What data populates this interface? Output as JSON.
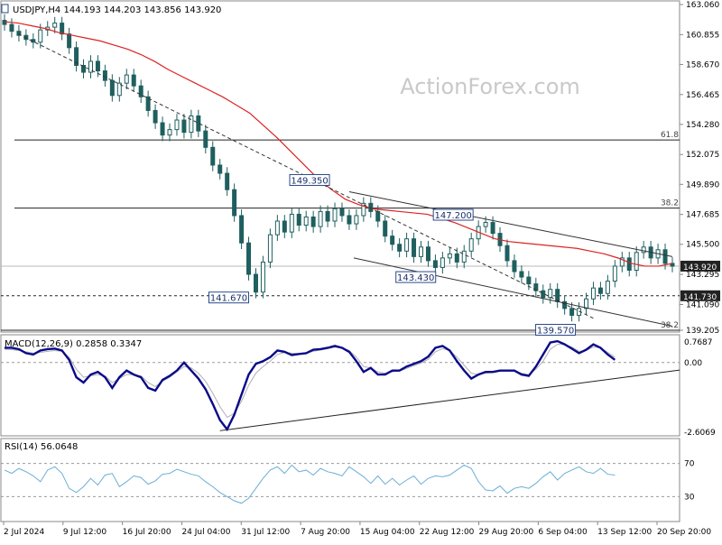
{
  "header": {
    "symbol_line": "USDJPY,H4  144.193 144.203 143.856 143.920",
    "watermark": "ActionForex.com"
  },
  "colors": {
    "candle": "#1f5f5f",
    "sma": "#dd2222",
    "macd_line": "#0a0a8a",
    "macd_signal": "#b0b0b0",
    "rsi": "#6aaed6",
    "trend": "#333333"
  },
  "chart_data": [
    {
      "type": "line",
      "title": "USDJPY,H4",
      "ohlc_last": {
        "open": 144.193,
        "high": 144.203,
        "low": 143.856,
        "close": 143.92
      },
      "x_ticks": [
        "2 Jul 2024",
        "9 Jul 12:00",
        "16 Jul 20:00",
        "24 Jul 04:00",
        "31 Jul 12:00",
        "7 Aug 20:00",
        "15 Aug 04:00",
        "22 Aug 12:00",
        "29 Aug 20:00",
        "6 Sep 04:00",
        "13 Sep 12:00",
        "20 Sep 20:00"
      ],
      "y_ticks": [
        "163.060",
        "160.855",
        "158.670",
        "156.465",
        "154.280",
        "152.075",
        "149.890",
        "147.685",
        "145.500",
        "143.295",
        "141.090",
        "139.205"
      ],
      "ylim": [
        139.205,
        163.06
      ],
      "close_series": [
        161.6,
        161.1,
        160.8,
        160.5,
        160.3,
        161.2,
        161.4,
        161.7,
        160.9,
        159.9,
        158.6,
        158.1,
        158.9,
        158.2,
        157.5,
        156.4,
        157.3,
        157.9,
        157.1,
        156.3,
        155.3,
        154.4,
        153.5,
        153.9,
        154.6,
        153.7,
        154.9,
        153.8,
        152.6,
        151.3,
        150.7,
        149.5,
        147.6,
        145.6,
        143.3,
        142.0,
        144.2,
        146.2,
        147.2,
        146.4,
        147.7,
        146.9,
        147.5,
        146.8,
        147.9,
        147.2,
        148.1,
        147.6,
        147.0,
        147.6,
        148.5,
        147.9,
        147.2,
        146.1,
        145.5,
        145.0,
        145.9,
        144.6,
        145.3,
        144.3,
        143.8,
        144.5,
        144.8,
        144.2,
        145.0,
        145.9,
        146.8,
        147.1,
        146.3,
        145.4,
        144.3,
        143.5,
        143.1,
        142.6,
        142.1,
        141.6,
        142.2,
        141.3,
        140.8,
        140.3,
        140.8,
        141.5,
        142.3,
        141.9,
        142.8,
        143.9,
        144.5,
        143.6,
        144.9,
        145.3,
        144.5,
        145.1,
        144.1,
        143.9
      ],
      "sma_series": [
        161.8,
        161.7,
        161.5,
        161.3,
        161.0,
        160.8,
        160.6,
        160.4,
        160.1,
        159.8,
        159.4,
        158.9,
        158.3,
        157.8,
        157.3,
        156.8,
        156.3,
        155.7,
        155.1,
        154.2,
        153.3,
        152.3,
        151.3,
        150.3,
        149.5,
        148.8,
        148.4,
        148.1,
        148.0,
        147.9,
        147.8,
        147.7,
        147.4,
        147.1,
        146.7,
        146.3,
        145.9,
        145.7,
        145.6,
        145.5,
        145.4,
        145.3,
        145.2,
        145.0,
        144.8,
        144.5,
        144.1,
        143.9,
        143.9,
        144.1
      ],
      "levels": [
        {
          "label": "61.8",
          "value": 153.14
        },
        {
          "label": "38.2",
          "value": 148.15
        }
      ],
      "level_bottom_label": "38.2",
      "support_value": 141.73,
      "support_label": "141.730",
      "current_price_label": "143.920",
      "annotations": [
        "149.350",
        "147.200",
        "143.430",
        "141.670",
        "139.570"
      ]
    },
    {
      "type": "line",
      "title": "MACD(12,26,9) 0.2858 0.3347",
      "y_ticks": [
        "0.7687",
        "0.00",
        "-2.6069"
      ],
      "ylim": [
        -2.6069,
        0.7687
      ],
      "macd_series": [
        0.55,
        0.55,
        0.5,
        0.35,
        0.3,
        0.45,
        0.5,
        0.52,
        0.45,
        0.1,
        -0.55,
        -0.75,
        -0.45,
        -0.35,
        -0.55,
        -0.95,
        -0.55,
        -0.3,
        -0.45,
        -0.55,
        -0.95,
        -1.05,
        -0.65,
        -0.5,
        -0.3,
        0.0,
        -0.3,
        -0.6,
        -1.0,
        -1.55,
        -2.15,
        -2.5,
        -1.95,
        -1.2,
        -0.45,
        -0.05,
        0.05,
        0.2,
        0.45,
        0.4,
        0.28,
        0.32,
        0.35,
        0.48,
        0.5,
        0.55,
        0.62,
        0.55,
        0.4,
        0.05,
        -0.35,
        -0.2,
        -0.45,
        -0.45,
        -0.3,
        -0.3,
        -0.15,
        -0.05,
        0.05,
        0.22,
        0.55,
        0.62,
        0.45,
        0.05,
        -0.3,
        -0.6,
        -0.45,
        -0.35,
        -0.35,
        -0.3,
        -0.3,
        -0.3,
        -0.45,
        -0.5,
        -0.15,
        0.3,
        0.75,
        0.8,
        0.68,
        0.52,
        0.35,
        0.48,
        0.68,
        0.55,
        0.3,
        0.1
      ],
      "signal_series": [
        0.5,
        0.48,
        0.45,
        0.4,
        0.35,
        0.38,
        0.42,
        0.45,
        0.42,
        0.2,
        -0.25,
        -0.55,
        -0.5,
        -0.45,
        -0.5,
        -0.75,
        -0.6,
        -0.45,
        -0.45,
        -0.5,
        -0.75,
        -0.9,
        -0.7,
        -0.55,
        -0.35,
        -0.15,
        -0.2,
        -0.4,
        -0.7,
        -1.15,
        -1.65,
        -2.05,
        -1.9,
        -1.45,
        -0.85,
        -0.4,
        -0.15,
        0.05,
        0.3,
        0.38,
        0.35,
        0.33,
        0.35,
        0.42,
        0.47,
        0.52,
        0.58,
        0.55,
        0.45,
        0.2,
        -0.15,
        -0.2,
        -0.35,
        -0.4,
        -0.35,
        -0.32,
        -0.22,
        -0.12,
        -0.02,
        0.12,
        0.4,
        0.52,
        0.45,
        0.2,
        -0.1,
        -0.4,
        -0.45,
        -0.4,
        -0.38,
        -0.33,
        -0.32,
        -0.32,
        -0.4,
        -0.45,
        -0.25,
        0.05,
        0.5,
        0.68,
        0.68,
        0.58,
        0.42,
        0.45,
        0.58,
        0.55,
        0.38,
        0.2
      ],
      "trendline": {
        "from": {
          "bar": 30,
          "value": -2.55
        },
        "to": {
          "bar": 85,
          "value": -0.28
        }
      }
    },
    {
      "type": "line",
      "title": "RSI(14) 56.0648",
      "y_ticks": [
        "70",
        "30"
      ],
      "ylim": [
        0,
        100
      ],
      "rsi_series": [
        62,
        58,
        64,
        60,
        55,
        48,
        62,
        66,
        58,
        40,
        35,
        42,
        52,
        44,
        56,
        58,
        42,
        48,
        55,
        53,
        45,
        49,
        57,
        58,
        63,
        60,
        57,
        55,
        48,
        42,
        35,
        30,
        25,
        22,
        28,
        40,
        52,
        62,
        66,
        58,
        68,
        60,
        62,
        56,
        64,
        60,
        58,
        55,
        66,
        60,
        54,
        46,
        55,
        45,
        52,
        44,
        50,
        55,
        45,
        52,
        55,
        54,
        56,
        62,
        68,
        64,
        48,
        38,
        37,
        43,
        34,
        40,
        42,
        40,
        46,
        54,
        60,
        50,
        58,
        62,
        66,
        60,
        58,
        64,
        57,
        56
      ]
    }
  ]
}
